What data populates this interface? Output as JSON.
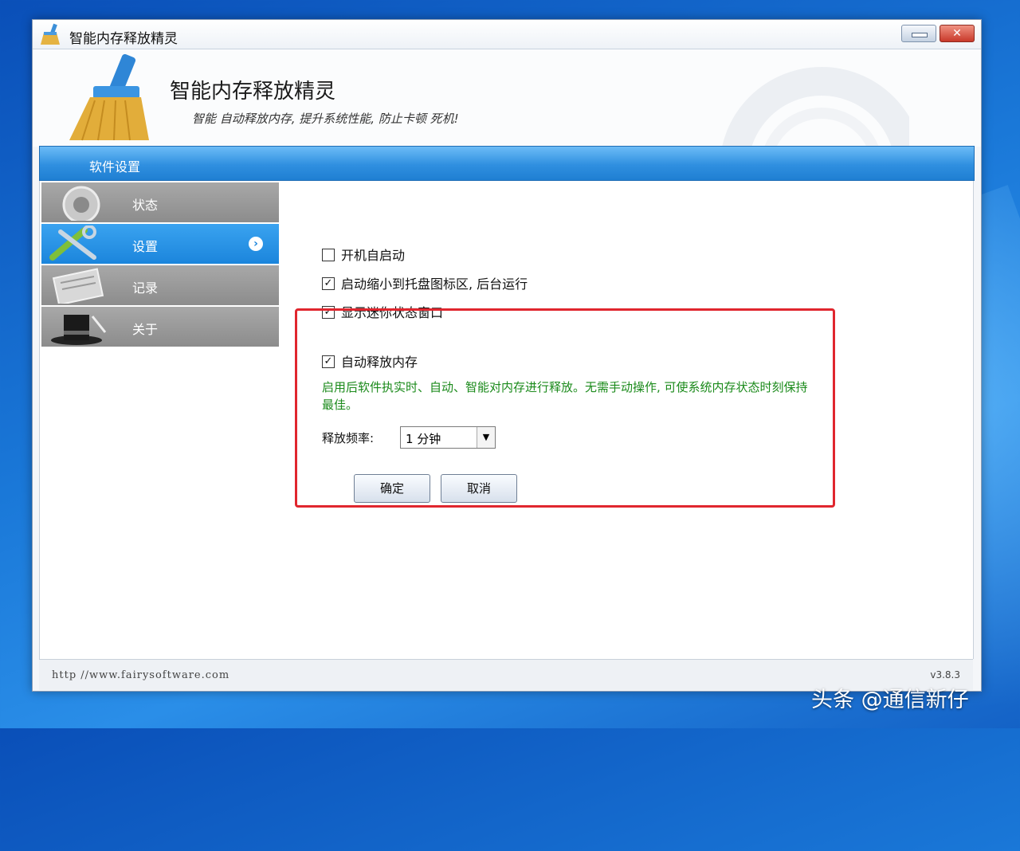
{
  "window": {
    "title": "智能内存释放精灵"
  },
  "banner": {
    "title": "智能内存释放精灵",
    "subtitle": "智能 自动释放内存, 提升系统性能, 防止卡顿 死机!"
  },
  "section": {
    "title": "软件设置"
  },
  "sidebar": {
    "items": [
      {
        "label": "状态",
        "active": false
      },
      {
        "label": "设置",
        "active": true
      },
      {
        "label": "记录",
        "active": false
      },
      {
        "label": "关于",
        "active": false
      }
    ]
  },
  "settings": {
    "autostart": {
      "label": "开机自启动",
      "checked": false
    },
    "minimize_tray": {
      "label": "启动缩小到托盘图标区, 后台运行",
      "checked": true
    },
    "mini_window": {
      "label": "显示迷你状态窗口",
      "checked": true
    },
    "auto_release": {
      "label": "自动释放内存",
      "checked": true
    },
    "description": "启用后软件执实时、自动、智能对内存进行释放。无需手动操作, 可使系统内存状态时刻保持最佳。",
    "frequency_label": "释放频率:",
    "frequency_value": "1 分钟",
    "ok_label": "确定",
    "cancel_label": "取消"
  },
  "footer": {
    "url": "http //www.fairysoftware.com",
    "version": "v3.8.3"
  },
  "watermark": "头条 @通信新仔",
  "colors": {
    "accent_blue": "#2f8fe0",
    "highlight_red": "#e0262e",
    "description_green": "#1a8a1a"
  }
}
